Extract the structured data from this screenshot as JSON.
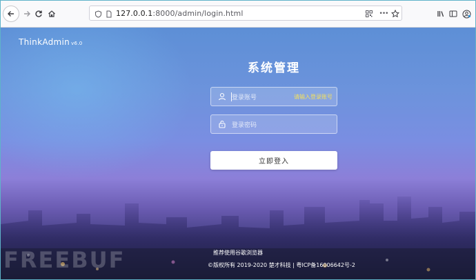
{
  "browser": {
    "url_host": "127.0.0.1",
    "url_rest": ":8000/admin/login.html",
    "icons": {
      "back": "back-arrow-icon",
      "forward": "forward-arrow-icon",
      "reload": "reload-icon",
      "home": "home-icon",
      "shield": "tracking-shield-icon",
      "page": "page-info-icon",
      "qr": "qr-code-icon",
      "more": "more-actions-icon",
      "bookmark": "bookmark-star-icon",
      "library": "library-icon",
      "sidebar": "sidebar-icon",
      "account": "account-icon"
    },
    "more_label": "•••"
  },
  "page": {
    "brand": "ThinkAdmin",
    "version": "v6.0",
    "title": "系统管理",
    "username": {
      "placeholder": "登录账号",
      "error": "请输入登录账号"
    },
    "password": {
      "placeholder": "登录密码"
    },
    "login_button": "立即登入",
    "footer_tip": "推荐使用谷歌浏览器",
    "footer_copyright": "©版权所有 2019-2020 楚才科技 | 粤ICP备16006642号-2",
    "watermark": "FREEBUF",
    "colors": {
      "error": "#f5e15b",
      "button_bg": "#ffffff"
    }
  }
}
